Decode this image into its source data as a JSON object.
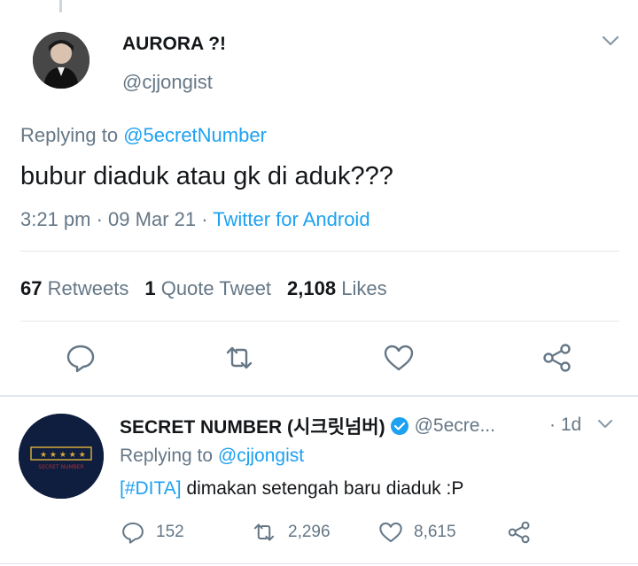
{
  "tweet": {
    "display_name": "AURORA ?!",
    "handle": "@cjjongist",
    "replying_prefix": "Replying to ",
    "replying_to": "@5ecretNumber",
    "text": "bubur diaduk atau gk di aduk???",
    "time_date": "3:21 pm · 09 Mar 21 · ",
    "source": "Twitter for Android",
    "stats": {
      "retweets_count": "67",
      "retweets_label": "Retweets",
      "quotes_count": "1",
      "quotes_label": "Quote Tweet",
      "likes_count": "2,108",
      "likes_label": "Likes"
    },
    "actions": [
      "reply-icon",
      "retweet-icon",
      "like-icon",
      "share-icon"
    ]
  },
  "reply": {
    "display_name": "SECRET NUMBER (시크릿넘버)",
    "handle": "@5ecre...",
    "time": "· 1d",
    "replying_prefix": "Replying to ",
    "replying_to": "@cjjongist",
    "hashtag": "[#DITA]",
    "text": " dimakan setengah baru diaduk :P",
    "avatar_logo_text": "SECRET NUMBER",
    "reply_count": "152",
    "retweet_count": "2,296",
    "like_count": "8,615"
  },
  "colors": {
    "accent": "#1da1f2",
    "muted": "#657786",
    "text": "#14171a",
    "divider": "#e1e8ed",
    "verified": "#1da1f2",
    "logo_bg": "#0f1d3f",
    "logo_gold": "#d4a93a"
  }
}
